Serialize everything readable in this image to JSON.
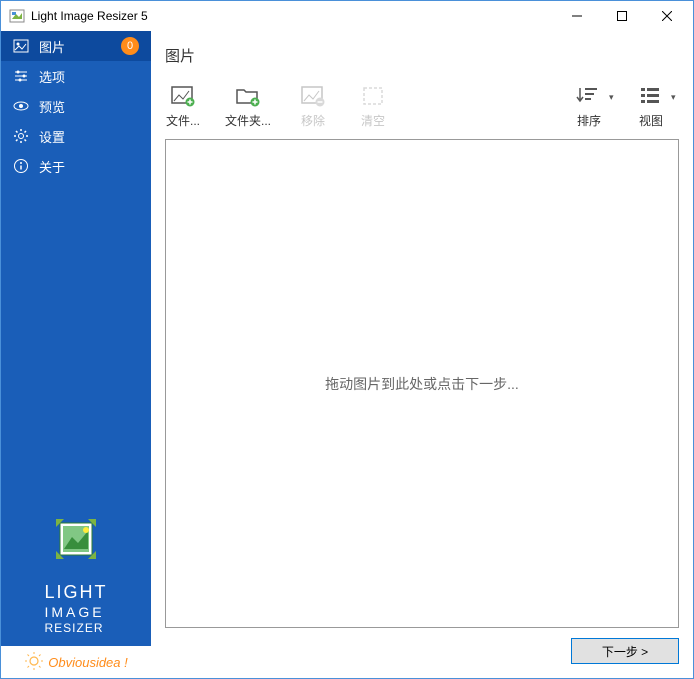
{
  "window": {
    "title": "Light Image Resizer 5"
  },
  "sidebar": {
    "items": [
      {
        "label": "图片",
        "badge": "0",
        "icon": "image-icon"
      },
      {
        "label": "选项",
        "icon": "sliders-icon"
      },
      {
        "label": "预览",
        "icon": "eye-icon"
      },
      {
        "label": "设置",
        "icon": "gear-icon"
      },
      {
        "label": "关于",
        "icon": "info-icon"
      }
    ],
    "logo": {
      "line1": "LIGHT",
      "line2": "IMAGE",
      "line3": "RESIZER"
    },
    "footer": "Obviousidea !"
  },
  "main": {
    "title": "图片",
    "toolbar": {
      "add_file": "文件...",
      "add_folder": "文件夹...",
      "remove": "移除",
      "clear": "清空",
      "sort": "排序",
      "view": "视图"
    },
    "canvas_hint": "拖动图片到此处或点击下一步...",
    "next_button": "下一步 >"
  }
}
